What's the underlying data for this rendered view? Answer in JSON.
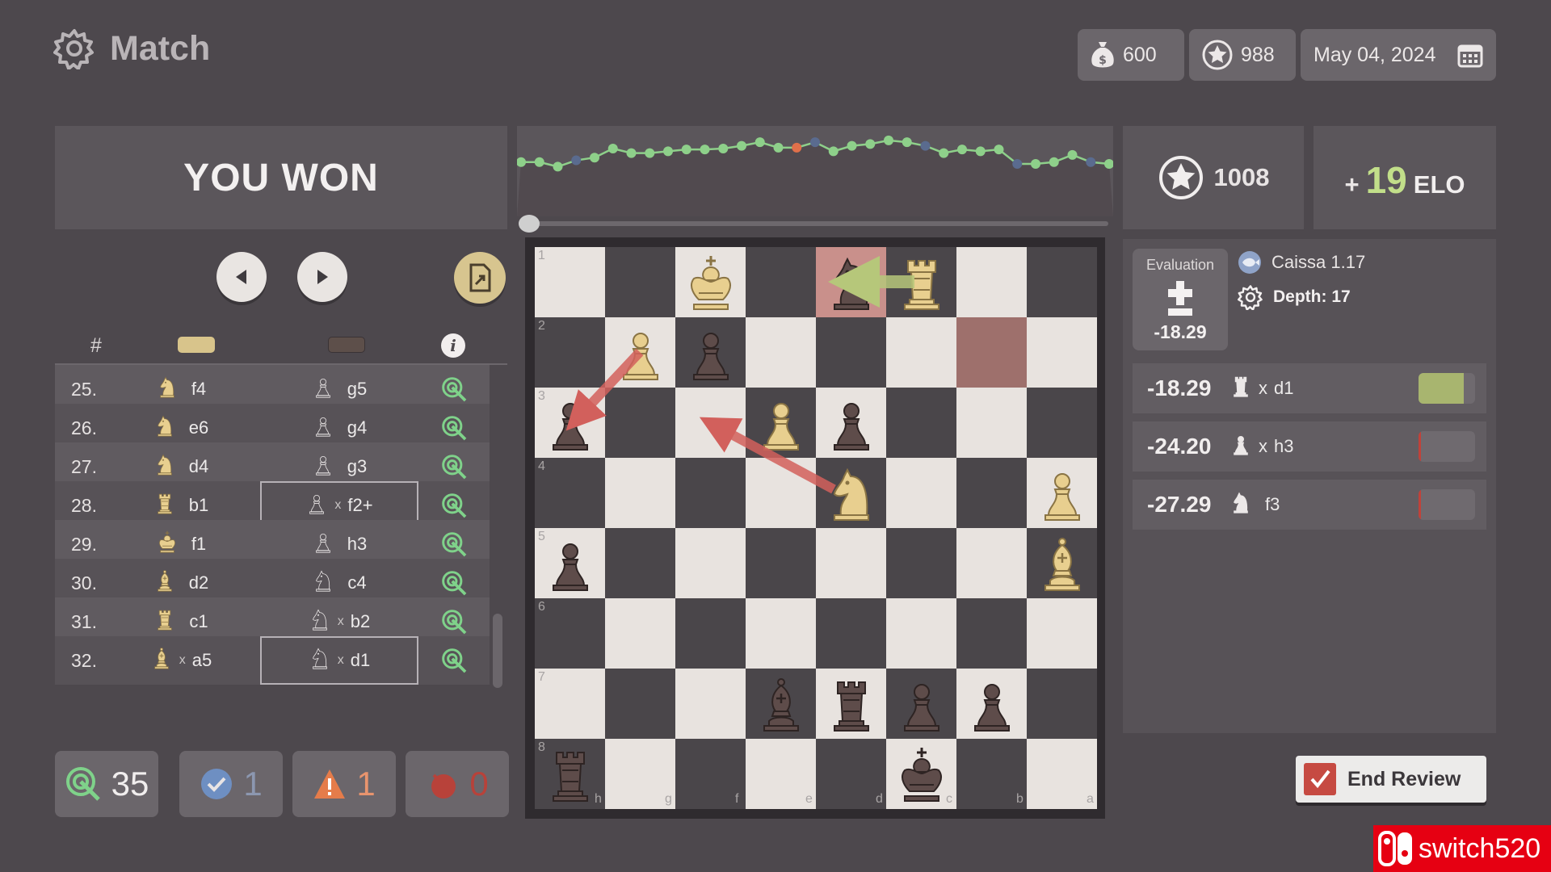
{
  "header": {
    "title": "Match",
    "coins": "600",
    "stars": "988",
    "date": "May 04, 2024"
  },
  "result": {
    "text": "YOU WON",
    "score": "1008",
    "elo_sign": "+",
    "elo_value": "19",
    "elo_label": "ELO"
  },
  "graph": {
    "points": [
      0.4,
      0.4,
      0.45,
      0.38,
      0.35,
      0.25,
      0.3,
      0.3,
      0.28,
      0.26,
      0.26,
      0.25,
      0.22,
      0.18,
      0.24,
      0.24,
      0.18,
      0.28,
      0.22,
      0.2,
      0.16,
      0.18,
      0.22,
      0.3,
      0.26,
      0.28,
      0.26,
      0.42,
      0.42,
      0.4,
      0.32,
      0.4,
      0.42
    ],
    "marker_colors": [
      "#8ed08a",
      "#8ed08a",
      "#8ed08a",
      "#5a6b8f",
      "#8ed08a",
      "#8ed08a",
      "#8ed08a",
      "#8ed08a",
      "#8ed08a",
      "#8ed08a",
      "#8ed08a",
      "#8ed08a",
      "#8ed08a",
      "#8ed08a",
      "#8ed08a",
      "#e0704a",
      "#5a6b8f",
      "#8ed08a",
      "#8ed08a",
      "#8ed08a",
      "#8ed08a",
      "#8ed08a",
      "#5a6b8f",
      "#8ed08a",
      "#8ed08a",
      "#8ed08a",
      "#8ed08a",
      "#5a6b8f",
      "#8ed08a",
      "#8ed08a",
      "#8ed08a",
      "#5a6b8f",
      "#8ed08a"
    ],
    "position": 0
  },
  "move_list": {
    "header_hash": "#",
    "info_label": "i",
    "rows": [
      {
        "no": "25.",
        "white": {
          "piece": "N",
          "capture": "",
          "square": "f4"
        },
        "black": {
          "piece": "P",
          "capture": "",
          "square": "g5"
        }
      },
      {
        "no": "26.",
        "white": {
          "piece": "N",
          "capture": "",
          "square": "e6"
        },
        "black": {
          "piece": "P",
          "capture": "",
          "square": "g4"
        }
      },
      {
        "no": "27.",
        "white": {
          "piece": "N",
          "capture": "",
          "square": "d4"
        },
        "black": {
          "piece": "P",
          "capture": "",
          "square": "g3"
        }
      },
      {
        "no": "28.",
        "white": {
          "piece": "R",
          "capture": "",
          "square": "b1"
        },
        "black": {
          "piece": "P",
          "capture": "x",
          "square": "f2+"
        }
      },
      {
        "no": "29.",
        "white": {
          "piece": "K",
          "capture": "",
          "square": "f1"
        },
        "black": {
          "piece": "P",
          "capture": "",
          "square": "h3"
        }
      },
      {
        "no": "30.",
        "white": {
          "piece": "B",
          "capture": "",
          "square": "d2"
        },
        "black": {
          "piece": "N",
          "capture": "",
          "square": "c4"
        }
      },
      {
        "no": "31.",
        "white": {
          "piece": "R",
          "capture": "",
          "square": "c1"
        },
        "black": {
          "piece": "N",
          "capture": "x",
          "square": "b2"
        }
      },
      {
        "no": "32.",
        "white": {
          "piece": "B",
          "capture": "x",
          "square": "a5"
        },
        "black": {
          "piece": "N",
          "capture": "x",
          "square": "d1"
        }
      }
    ]
  },
  "stats": {
    "best": "35",
    "good": "1",
    "mistakes": "1",
    "blunders": "0"
  },
  "board": {
    "ranks": [
      "1",
      "2",
      "3",
      "4",
      "5",
      "6",
      "7",
      "8"
    ],
    "files": [
      "h",
      "g",
      "f",
      "e",
      "d",
      "c",
      "b",
      "a"
    ],
    "highlight": [
      "1-4",
      "2-6"
    ],
    "pieces": [
      {
        "sq": "1-2",
        "type": "K",
        "color": "w"
      },
      {
        "sq": "1-4",
        "type": "N",
        "color": "b"
      },
      {
        "sq": "1-5",
        "type": "R",
        "color": "w"
      },
      {
        "sq": "2-1",
        "type": "P",
        "color": "w"
      },
      {
        "sq": "2-2",
        "type": "P",
        "color": "b"
      },
      {
        "sq": "3-0",
        "type": "P",
        "color": "b"
      },
      {
        "sq": "3-3",
        "type": "P",
        "color": "w"
      },
      {
        "sq": "3-4",
        "type": "P",
        "color": "b"
      },
      {
        "sq": "4-4",
        "type": "N",
        "color": "w"
      },
      {
        "sq": "4-7",
        "type": "P",
        "color": "w"
      },
      {
        "sq": "5-0",
        "type": "P",
        "color": "b"
      },
      {
        "sq": "5-7",
        "type": "B",
        "color": "w"
      },
      {
        "sq": "7-3",
        "type": "B",
        "color": "b"
      },
      {
        "sq": "7-4",
        "type": "R",
        "color": "b"
      },
      {
        "sq": "7-5",
        "type": "P",
        "color": "b"
      },
      {
        "sq": "7-6",
        "type": "P",
        "color": "b"
      },
      {
        "sq": "8-0",
        "type": "R",
        "color": "b"
      },
      {
        "sq": "8-5",
        "type": "K",
        "color": "b"
      }
    ]
  },
  "engine": {
    "eval_label": "Evaluation",
    "eval_value": "-18.29",
    "name": "Caissa 1.17",
    "depth_label": "Depth: 17",
    "lines": [
      {
        "score": "-18.29",
        "piece": "R",
        "capture": "x",
        "square": "d1",
        "bar_color": "#a8b56f",
        "fill": 0.8
      },
      {
        "score": "-24.20",
        "piece": "P",
        "capture": "x",
        "square": "h3",
        "bar_color": "#c0423a",
        "fill": 0.04
      },
      {
        "score": "-27.29",
        "piece": "N",
        "capture": "",
        "square": "f3",
        "bar_color": "#c0423a",
        "fill": 0.03
      }
    ]
  },
  "end_button": "End Review",
  "watermark": "switch520",
  "colors": {
    "white_piece": "#e8cf8f",
    "black_piece": "#5e4c4a",
    "accent_green": "#c2df8a"
  }
}
